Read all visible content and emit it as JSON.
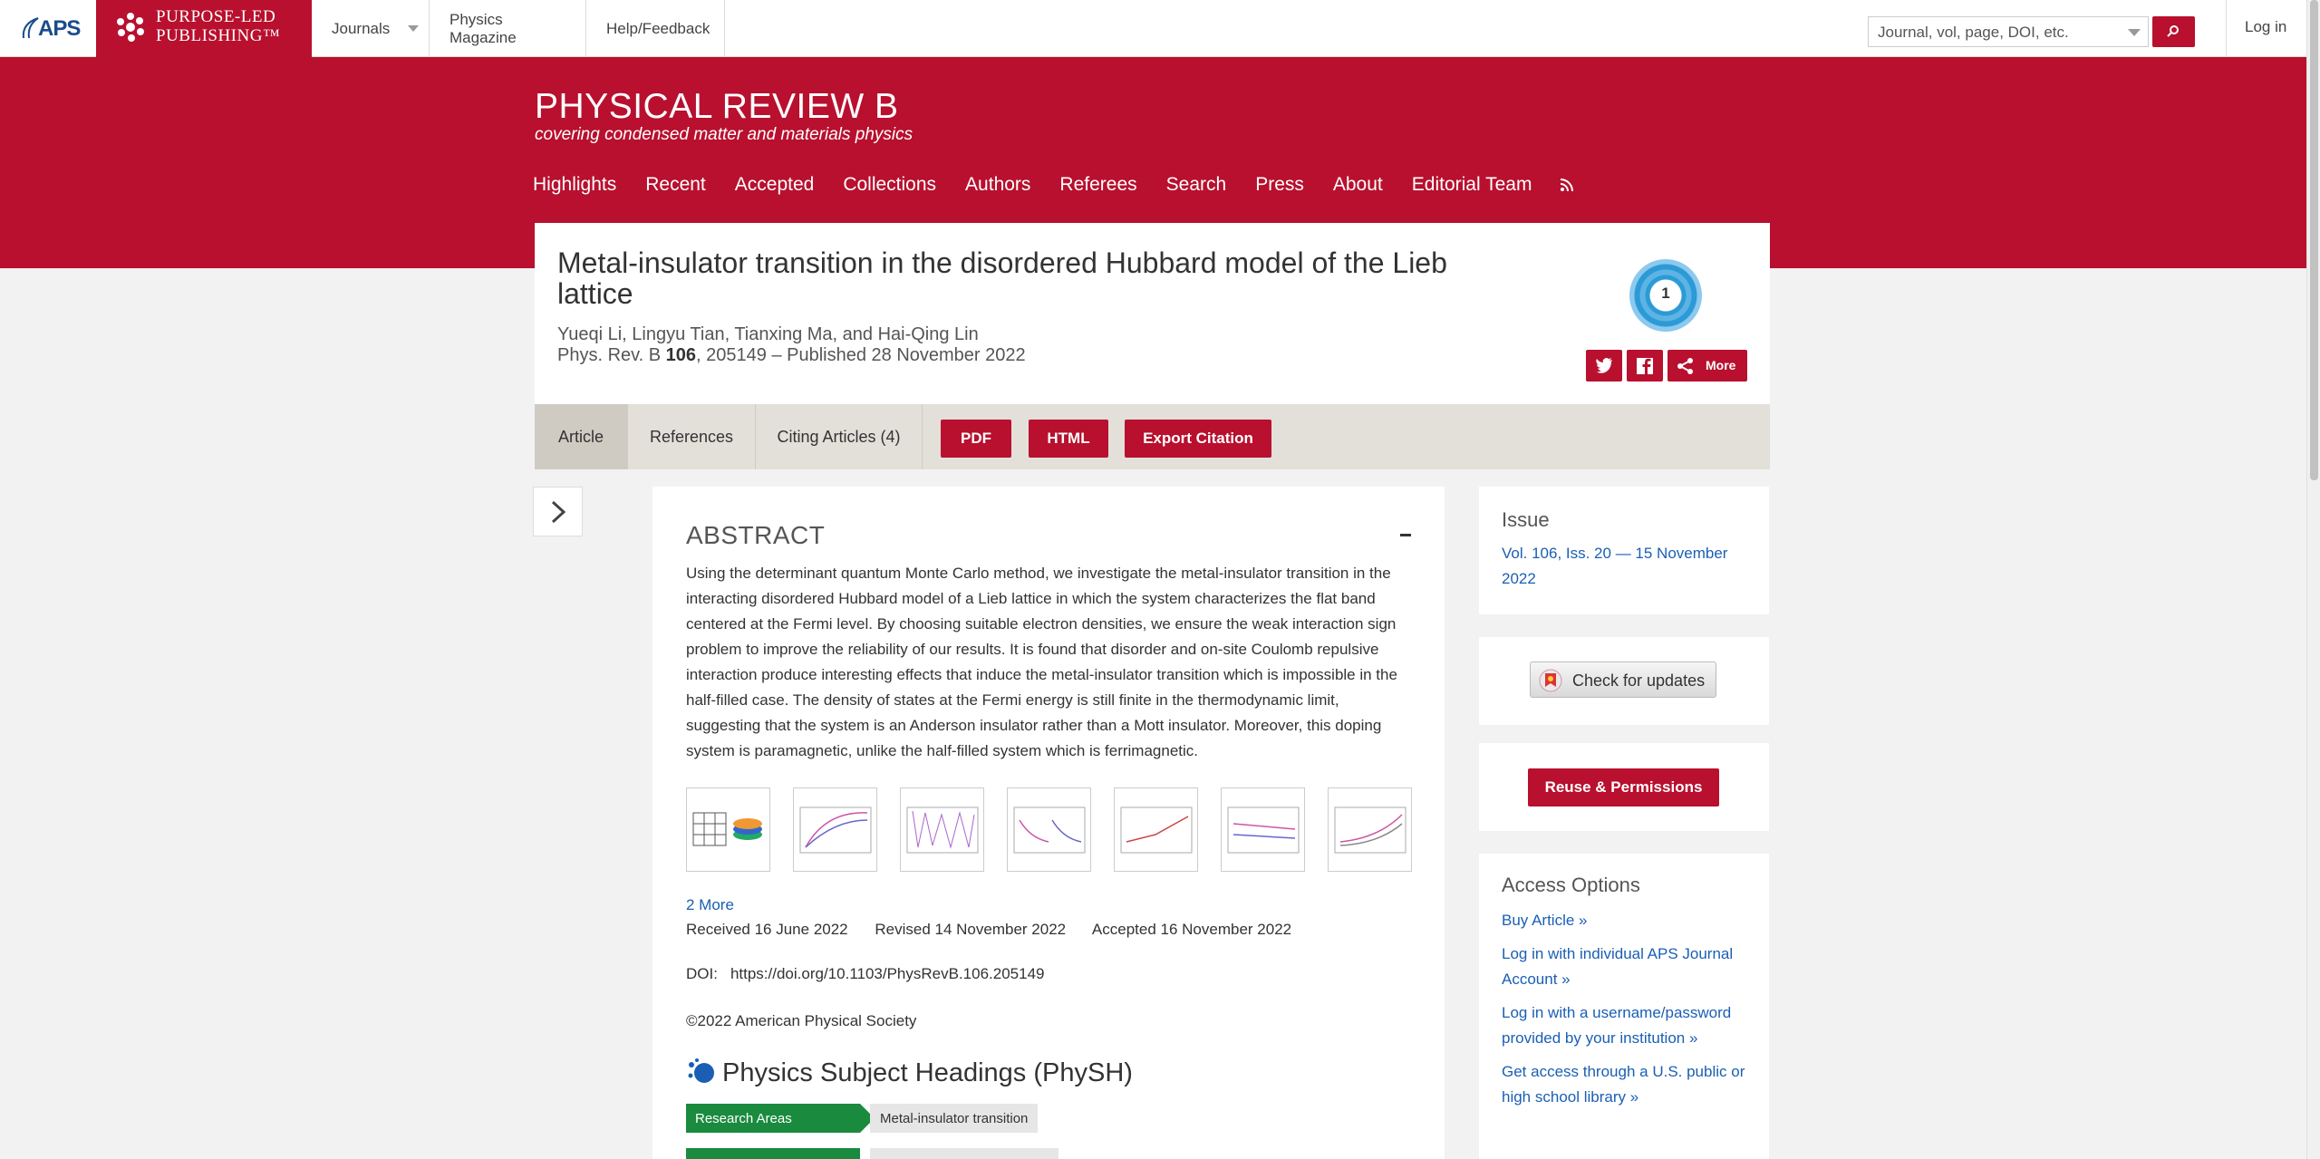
{
  "topbar": {
    "aps_logo": "APS",
    "plp_line1": "PURPOSE-LED",
    "plp_line2": "PUBLISHING™",
    "journals": "Journals",
    "physics_magazine": "Physics Magazine",
    "help": "Help/Feedback",
    "search_placeholder": "Journal, vol, page, DOI, etc.",
    "login": "Log in"
  },
  "journal": {
    "title": "PHYSICAL REVIEW B",
    "subtitle": "covering condensed matter and materials physics",
    "nav": [
      "Highlights",
      "Recent",
      "Accepted",
      "Collections",
      "Authors",
      "Referees",
      "Search",
      "Press",
      "About",
      "Editorial Team"
    ]
  },
  "article": {
    "title": "Metal-insulator transition in the disordered Hubbard model of the Lieb lattice",
    "authors": "Yueqi Li, Lingyu Tian, Tianxing Ma, and Hai-Qing Lin",
    "cite_prefix": "Phys. Rev. B ",
    "cite_volume": "106",
    "cite_suffix": ", 205149 – Published 28 November 2022",
    "altmetric_score": "1",
    "share_more": "More"
  },
  "tabs": {
    "article": "Article",
    "references": "References",
    "citing": "Citing Articles (4)",
    "pdf": "PDF",
    "html": "HTML",
    "export": "Export Citation"
  },
  "abstract": {
    "heading": "ABSTRACT",
    "text": "Using the determinant quantum Monte Carlo method, we investigate the metal-insulator transition in the interacting disordered Hubbard model of a Lieb lattice in which the system characterizes the flat band centered at the Fermi level. By choosing suitable electron densities, we ensure the weak interaction sign problem to improve the reliability of our results. It is found that disorder and on-site Coulomb repulsive interaction produce interesting effects that induce the metal-insulator transition which is impossible in the half-filled case. The density of states at the Fermi energy is still finite in the thermodynamic limit, suggesting that the system is an Anderson insulator rather than a Mott insulator. Moreover, this doping system is paramagnetic, unlike the half-filled system which is ferrimagnetic.",
    "more_figures": "2 More",
    "received": "Received 16 June 2022",
    "revised": "Revised 14 November 2022",
    "accepted": "Accepted 16 November 2022",
    "doi_label": "DOI:",
    "doi": "https://doi.org/10.1103/PhysRevB.106.205149",
    "copyright": "©2022 American Physical Society",
    "physh_heading": "Physics Subject Headings (PhySH)",
    "research_areas_label": "Research Areas",
    "research_area_value": "Metal-insulator transition"
  },
  "sidebar": {
    "issue_heading": "Issue",
    "issue_value": "Vol. 106, Iss. 20 — 15 November 2022",
    "check_updates": "Check for updates",
    "reuse": "Reuse & Permissions",
    "access_heading": "Access Options",
    "access_items": [
      "Buy Article »",
      "Log in with individual APS Journal Account »",
      "Log in with a username/password provided by your institution »",
      "Get access through a U.S. public or high school library »"
    ]
  },
  "colors": {
    "brand_red": "#b8102e",
    "link_blue": "#1a5fb4",
    "physh_green": "#1a8a3f"
  }
}
